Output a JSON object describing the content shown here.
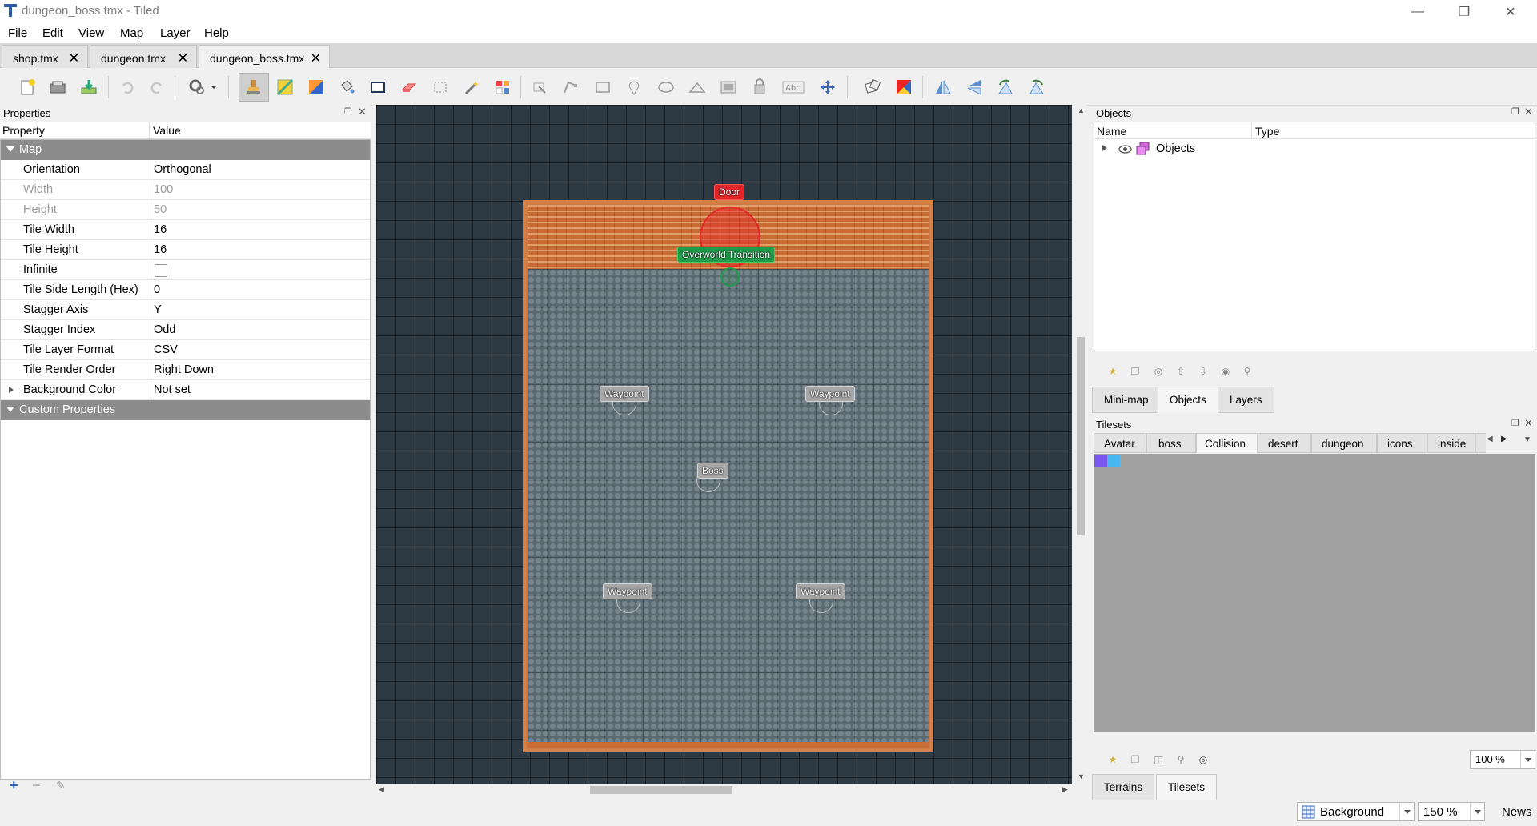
{
  "window": {
    "title": "dungeon_boss.tmx - Tiled"
  },
  "menu": [
    "File",
    "Edit",
    "View",
    "Map",
    "Layer",
    "Help"
  ],
  "doc_tabs": [
    {
      "label": "shop.tmx"
    },
    {
      "label": "dungeon.tmx"
    },
    {
      "label": "dungeon_boss.tmx",
      "active": true
    }
  ],
  "properties": {
    "panel_title": "Properties",
    "col_property": "Property",
    "col_value": "Value",
    "section_map": "Map",
    "rows": [
      {
        "key": "Orientation",
        "value": "Orthogonal"
      },
      {
        "key": "Width",
        "value": "100",
        "disabled": true
      },
      {
        "key": "Height",
        "value": "50",
        "disabled": true
      },
      {
        "key": "Tile Width",
        "value": "16"
      },
      {
        "key": "Tile Height",
        "value": "16"
      },
      {
        "key": "Infinite",
        "value": ""
      },
      {
        "key": "Tile Side Length (Hex)",
        "value": "0"
      },
      {
        "key": "Stagger Axis",
        "value": "Y"
      },
      {
        "key": "Stagger Index",
        "value": "Odd"
      },
      {
        "key": "Tile Layer Format",
        "value": "CSV"
      },
      {
        "key": "Tile Render Order",
        "value": "Right Down"
      },
      {
        "key": "Background Color",
        "value": "Not set"
      }
    ],
    "section_custom": "Custom Properties"
  },
  "map_objects": {
    "door": "Door",
    "transition": "Overworld Transition",
    "waypoint": "Waypoint",
    "boss": "Boss"
  },
  "objects_panel": {
    "title": "Objects",
    "col_name": "Name",
    "col_type": "Type",
    "group": "Objects",
    "tabs": [
      "Mini-map",
      "Objects",
      "Layers"
    ]
  },
  "tilesets_panel": {
    "title": "Tilesets",
    "tabs": [
      "Avatar",
      "boss",
      "Collision",
      "desert",
      "dungeon",
      "icons",
      "inside",
      "r"
    ],
    "active_tab": "Collision",
    "zoom": "100 %",
    "bottom_tabs": [
      "Terrains",
      "Tilesets"
    ]
  },
  "status": {
    "layer": "Background",
    "zoom": "150 %",
    "news": "News"
  },
  "colors": {
    "canvas_bg": "#2e3a43",
    "door": "#e4262b",
    "transition": "#1f9c4a",
    "section_header": "#8c8c8c"
  }
}
